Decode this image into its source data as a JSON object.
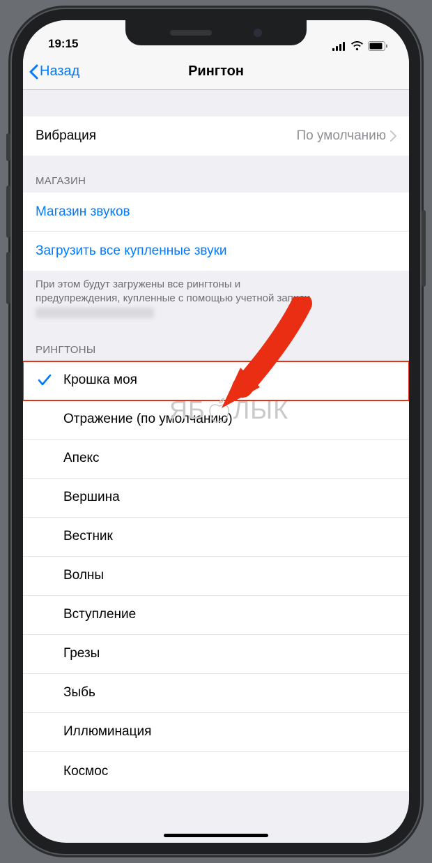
{
  "status": {
    "time": "19:15"
  },
  "nav": {
    "back": "Назад",
    "title": "Рингтон"
  },
  "vibration": {
    "label": "Вибрация",
    "value": "По умолчанию"
  },
  "store": {
    "header": "МАГАЗИН",
    "link_store": "Магазин звуков",
    "link_download": "Загрузить все купленные звуки",
    "footer_line1": "При этом будут загружены все рингтоны и",
    "footer_line2": "предупреждения, купленные с помощью учетной записи"
  },
  "ringtones": {
    "header": "РИНГТОНЫ",
    "items": [
      {
        "label": "Крошка моя",
        "selected": true,
        "highlight": true
      },
      {
        "label": "Отражение (по умолчанию)"
      },
      {
        "label": "Апекс"
      },
      {
        "label": "Вершина"
      },
      {
        "label": "Вестник"
      },
      {
        "label": "Волны"
      },
      {
        "label": "Вступление"
      },
      {
        "label": "Грезы"
      },
      {
        "label": "Зыбь"
      },
      {
        "label": "Иллюминация"
      },
      {
        "label": "Космос"
      }
    ]
  },
  "watermark": {
    "left": "ЯБ",
    "right": "ЛЫК"
  }
}
